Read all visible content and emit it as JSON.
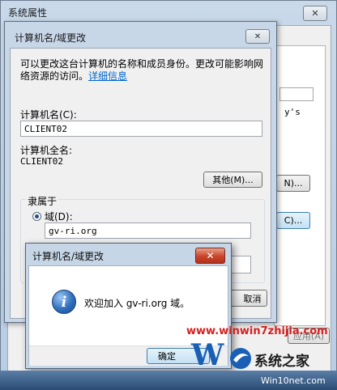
{
  "system_properties": {
    "title": "系统属性",
    "close_glyph": "✕",
    "fragment_text": "y's",
    "buttons": {
      "network_id_label": "N)...",
      "change_label": "C)...",
      "apply_label": "应用(A)"
    }
  },
  "computer_name_dialog": {
    "title": "计算机名/域更改",
    "close_glyph": "✕",
    "intro_text": "可以更改这台计算机的名称和成员身份。更改可能影响网",
    "intro_text_line2": "络资源的访问。",
    "details_link": "详细信息",
    "computer_name_label": "计算机名(C):",
    "computer_name_value": "CLIENT02",
    "full_name_label": "计算机全名:",
    "full_name_value": "CLIENT02",
    "more_button": "其他(M)...",
    "member_of_label": "隶属于",
    "domain_radio_label": "域(D):",
    "domain_value": "gv-ri.org",
    "cancel_fragment": "取消"
  },
  "welcome_dialog": {
    "title": "计算机名/域更改",
    "close_glyph": "✕",
    "info_icon_glyph": "i",
    "message": "欢迎加入 gv-ri.org 域。",
    "ok_button": "确定"
  },
  "watermark": {
    "url": "www.winwin7zhijia.com",
    "site_name": "系统之家",
    "site_url": "Win10net.com",
    "brand_fragment": "W"
  },
  "colors": {
    "accent": "#0066cc",
    "close_red": "#c8442a",
    "watermark_red": "#d61f1f"
  }
}
